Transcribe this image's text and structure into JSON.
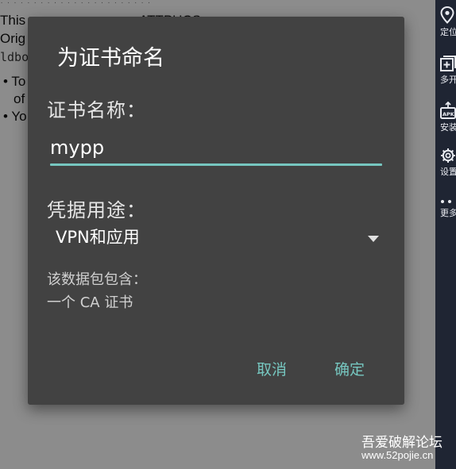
{
  "background_page": {
    "tiny_line": "· · · · · · · · · · · · · · · · · · · · · · ·",
    "line1": "This",
    "line1_right": "ATTPUCS",
    "line2": "Orig",
    "line3": "ldbo",
    "bullet1": "• To",
    "bullet1_cont": "of",
    "bullet2": "• Yo"
  },
  "sidebar": {
    "items": [
      {
        "label": "定位",
        "icon": "location-pin-icon"
      },
      {
        "label": "多开",
        "icon": "multi-open-icon"
      },
      {
        "label": "安装",
        "icon": "apk-install-icon"
      },
      {
        "label": "设置",
        "icon": "gear-icon"
      },
      {
        "label": "更多",
        "icon": "more-dots-icon"
      }
    ]
  },
  "dialog": {
    "title": "为证书命名",
    "name_label": "证书名称：",
    "name_value": "mypp",
    "usage_label": "凭据用途：",
    "usage_value": "VPN和应用",
    "info_line1": "该数据包包含：",
    "info_line2": "一个 CA 证书",
    "cancel_label": "取消",
    "ok_label": "确定"
  },
  "colors": {
    "dialog_bg": "#424242",
    "accent": "#76c7c0",
    "sidebar_bg": "#1f2533"
  },
  "watermark": {
    "line1": "吾爱破解论坛",
    "line2": "www.52pojie.cn"
  }
}
